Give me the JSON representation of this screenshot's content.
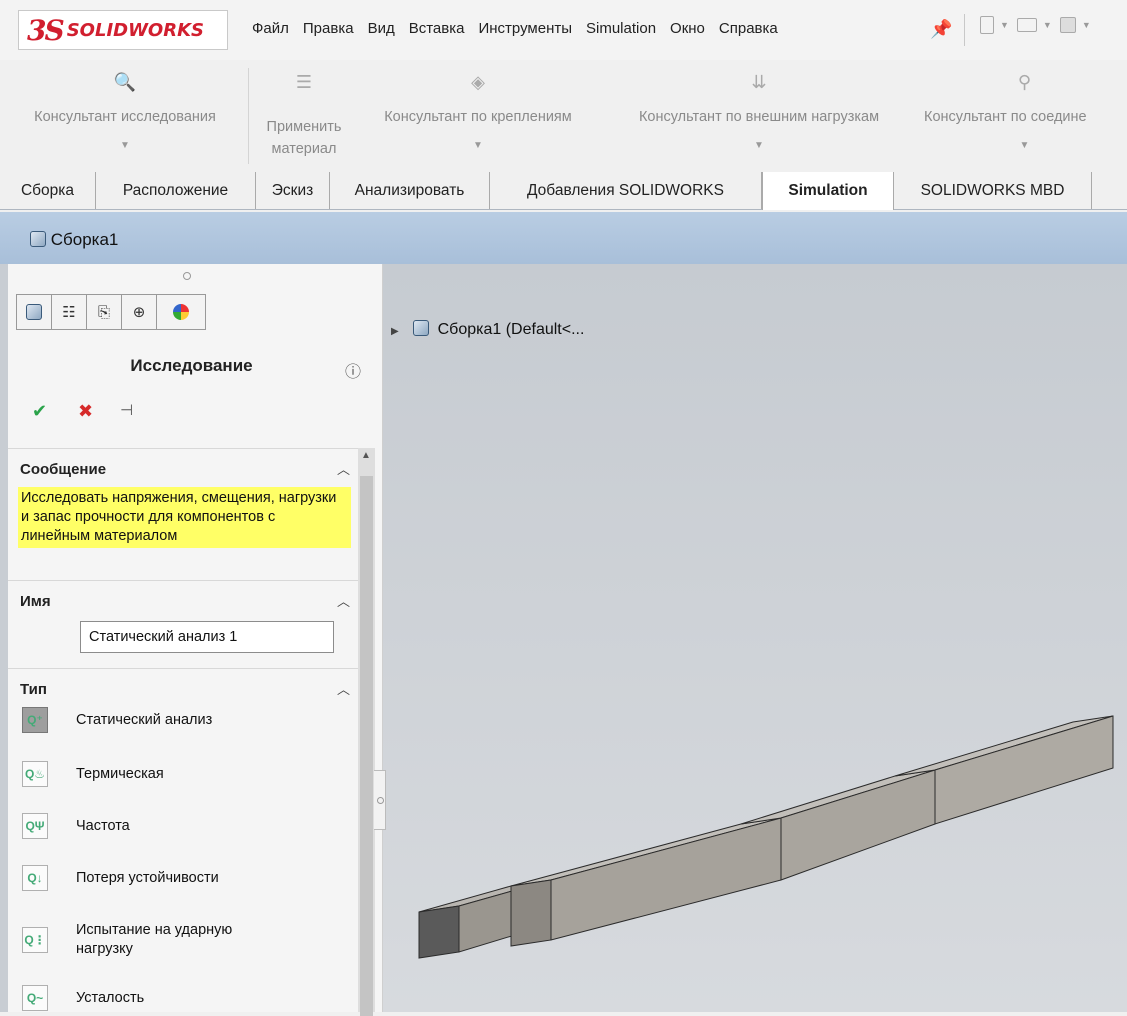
{
  "app": {
    "logo_ds": "3S",
    "logo_text": "SOLIDWORKS"
  },
  "menu": [
    "Файл",
    "Правка",
    "Вид",
    "Вставка",
    "Инструменты",
    "Simulation",
    "Окно",
    "Справка"
  ],
  "ribbon": [
    {
      "label1": "Консультант исследования",
      "label2": ""
    },
    {
      "label1": "Применить",
      "label2": "материал"
    },
    {
      "label1": "Консультант по креплениям",
      "label2": ""
    },
    {
      "label1": "Консультант по внешним нагрузкам",
      "label2": ""
    },
    {
      "label1": "Консультант по соедине",
      "label2": ""
    }
  ],
  "tabs": [
    "Сборка",
    "Расположение",
    "Эскиз",
    "Анализировать",
    "Добавления SOLIDWORKS",
    "Simulation",
    "SOLIDWORKS MBD"
  ],
  "active_tab": "Simulation",
  "document": {
    "title": "Сборка1",
    "tree_item": "Сборка1  (Default<..."
  },
  "pm": {
    "title": "Исследование",
    "help": "?",
    "message": {
      "header": "Сообщение",
      "text": "Исследовать напряжения, смещения, нагрузки и запас прочности для компонентов с линейным материалом"
    },
    "name": {
      "header": "Имя",
      "value": "Статический анализ 1"
    },
    "type": {
      "header": "Тип",
      "items": [
        "Статический анализ",
        "Термическая",
        "Частота",
        "Потеря устойчивости",
        "Испытание на ударную нагрузку",
        "Усталость"
      ]
    }
  },
  "colors": {
    "accent": "#d11f2f",
    "message_bg": "#ffff66",
    "titlebar": "#b9cde3"
  }
}
